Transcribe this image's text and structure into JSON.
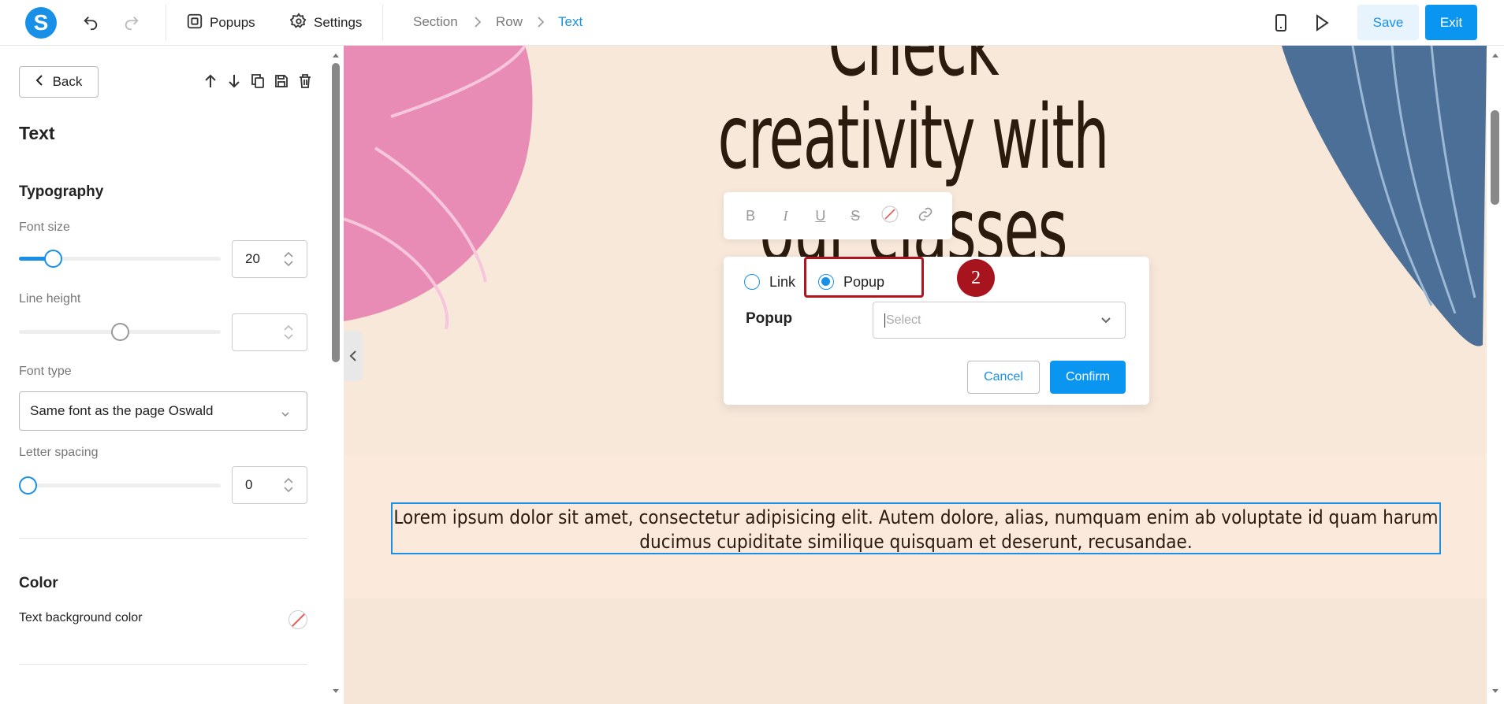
{
  "header": {
    "logo_letter": "S",
    "popups_label": "Popups",
    "settings_label": "Settings",
    "breadcrumb": [
      "Section",
      "Row",
      "Text"
    ],
    "save_label": "Save",
    "exit_label": "Exit",
    "accent": "#1890e8"
  },
  "sidebar": {
    "back_label": "Back",
    "title": "Text",
    "typography_heading": "Typography",
    "font_size_label": "Font size",
    "font_size_value": "20",
    "font_size_level": 0.17,
    "line_height_label": "Line height",
    "line_height_value": "",
    "line_height_level": 0.5,
    "font_type_label": "Font type",
    "font_type_value": "Same font as the page Oswald",
    "letter_spacing_label": "Letter spacing",
    "letter_spacing_value": "0",
    "letter_spacing_level": 0,
    "color_heading": "Color",
    "text_bg_color_label": "Text background color"
  },
  "canvas": {
    "headline_lines": [
      "Check",
      "creativity with",
      "our classes"
    ],
    "paragraph": "Lorem ipsum dolor sit amet, consectetur adipisicing elit. Autem dolore, alias, numquam enim ab voluptate id quam harum ducimus cupiditate similique quisquam et deserunt, recusandae.",
    "background": "#f7e8da"
  },
  "link_dialog": {
    "option_link": "Link",
    "option_popup": "Popup",
    "selected": "Popup",
    "popup_label": "Popup",
    "select_placeholder": "Select",
    "cancel_label": "Cancel",
    "confirm_label": "Confirm"
  },
  "annotation": {
    "step_number": "2",
    "color": "#a8141e"
  }
}
